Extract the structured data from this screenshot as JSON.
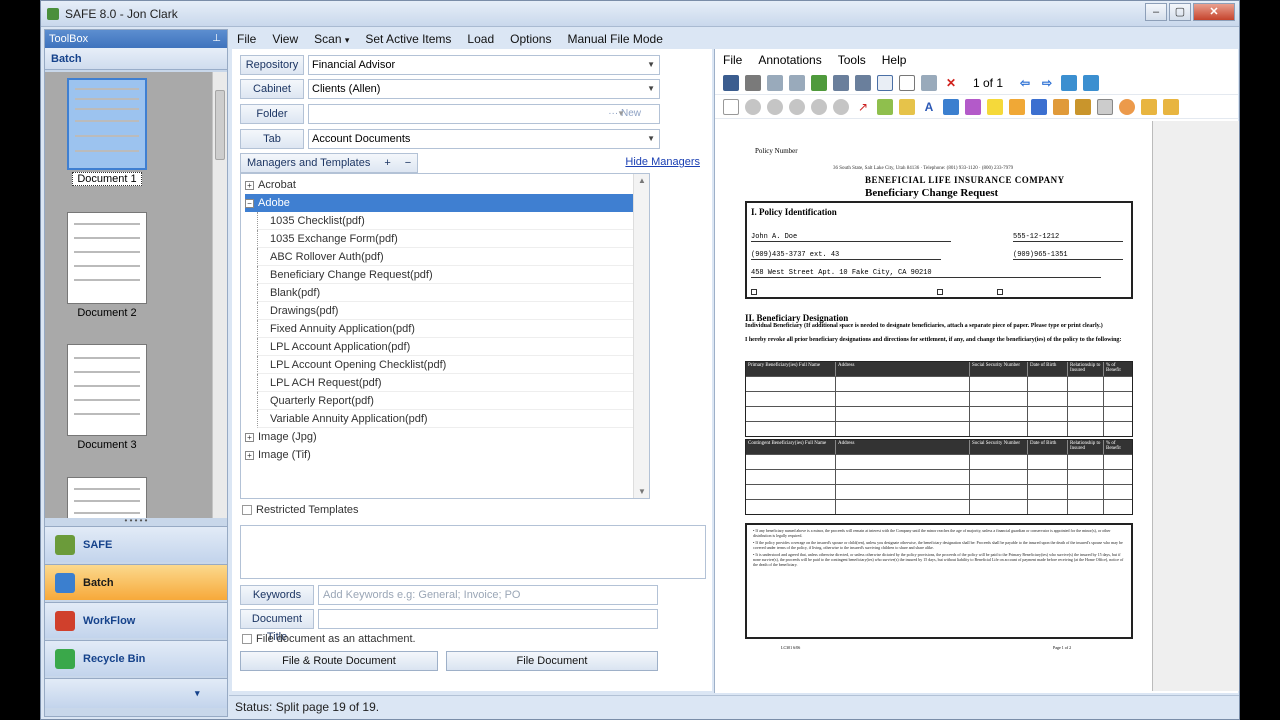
{
  "window": {
    "title": "SAFE 8.0 - Jon Clark",
    "buttons": [
      "–",
      "▢",
      "✕"
    ]
  },
  "toolbox": {
    "header": "ToolBox",
    "pin": "⊥",
    "section": "Batch",
    "documents": [
      "Document 1",
      "Document 2",
      "Document 3"
    ],
    "nav": [
      {
        "label": "SAFE",
        "color": "#6b9b3a"
      },
      {
        "label": "Batch",
        "color": "#3b7fcf"
      },
      {
        "label": "WorkFlow",
        "color": "#d0402c"
      },
      {
        "label": "Recycle Bin",
        "color": "#3aa84a"
      }
    ]
  },
  "menu": [
    "File",
    "View",
    "Scan",
    "Set Active Items",
    "Load",
    "Options",
    "Manual File Mode"
  ],
  "menu_scan_arrow": "▾",
  "form": {
    "repository": {
      "label": "Repository",
      "value": "Financial Advisor"
    },
    "cabinet": {
      "label": "Cabinet",
      "value": "Clients (Allen)"
    },
    "folder": {
      "label": "Folder",
      "value": "",
      "extra": "··· New"
    },
    "tab": {
      "label": "Tab",
      "value": "Account Documents"
    }
  },
  "managers": {
    "tab_label": "Managers and Templates",
    "add": "+",
    "remove": "−",
    "hide_link": "Hide Managers"
  },
  "tree": {
    "roots": [
      "Acrobat",
      "Adobe",
      "Image (Jpg)",
      "Image (Tif)"
    ],
    "adobe_children": [
      "1035 Checklist(pdf)",
      "1035 Exchange Form(pdf)",
      "ABC Rollover Auth(pdf)",
      "Beneficiary Change Request(pdf)",
      "Blank(pdf)",
      "Drawings(pdf)",
      "Fixed Annuity Application(pdf)",
      "LPL Account Application(pdf)",
      "LPL Account Opening Checklist(pdf)",
      "LPL ACH Request(pdf)",
      "Quarterly Report(pdf)",
      "Variable Annuity Application(pdf)"
    ]
  },
  "restricted_label": "Restricted Templates",
  "keywords": {
    "label": "Keywords",
    "placeholder": "Add Keywords e.g: General; Invoice; PO"
  },
  "doc_title": {
    "label": "Document Title",
    "value": ""
  },
  "attach_label": "File document as an attachment.",
  "buttons": {
    "file_route": "File & Route Document",
    "file_doc": "File Document"
  },
  "status": "Status: Split page 19 of 19.",
  "viewer": {
    "menu": [
      "File",
      "Annotations",
      "Tools",
      "Help"
    ],
    "pages": "1 of 1",
    "document": {
      "policy_number_label": "Policy Number",
      "company": "BENEFICIAL LIFE INSURANCE COMPANY",
      "title": "Beneficiary Change Request",
      "address": "36 South State, Salt Lake City, Utah 84136 · Telephone: (801) 933-1120 · (800) 233-7979",
      "section1": "I.    Policy Identification",
      "insured_name": "John A. Doe",
      "policy_no": "555-12-1212",
      "day_phone": "(909)435-3737 ext. 43",
      "eve_phone": "(909)965-1351",
      "address_line": "458 West Street Apt. 10 Fake City, CA 90210",
      "section2": "II.     Beneficiary Designation",
      "section2_sub": "Individual Beneficiary (If additional space is needed to designate beneficiaries, attach a separate piece of paper. Please type or print clearly.)",
      "revoke_text": "I hereby revoke all prior beneficiary designations and directions for settlement, if any, and change the beneficiary(ies) of the policy to the following:",
      "primary_headers": [
        "Primary Beneficiary(ies) Full Name",
        "Address",
        "Social Security Number",
        "Date of Birth",
        "Relationship to Insured",
        "% of Benefit"
      ],
      "contingent_headers": [
        "Contingent Beneficiary(ies) Full Name",
        "Address",
        "Social Security Number",
        "Date of Birth",
        "Relationship to Insured",
        "% of Benefit"
      ],
      "notes": [
        "• If any beneficiary named above is a minor, the proceeds will remain at interest with the Company until the minor reaches the age of majority, unless a financial guardian or conservator is appointed for the minor(s), or other distribution is legally required.",
        "• If the policy provides coverage on the insured's spouse or child(ren), unless you designate otherwise, the beneficiary designation shall be: Proceeds shall be payable to the insured upon the death of the insured's spouse who may be covered under terms of the policy, if living, otherwise to the insured's surviving children to share and share alike.",
        "• It is understood and agreed that, unless otherwise directed, or unless otherwise dictated by the policy provisions, the proceeds of the policy will be paid to the Primary Beneficiary(ies) who survive(s) the insured by 15 days, but if none survive(s), the proceeds will be paid to the contingent beneficiary(ies) who survive(s) the insured by 15 days, but without liability to Beneficial Life on account of payment made before receiving (at the Home Office), notice of the death of the beneficiary."
      ],
      "footer_left": "LC301     6/06",
      "footer_right": "Page 1 of 2"
    }
  }
}
